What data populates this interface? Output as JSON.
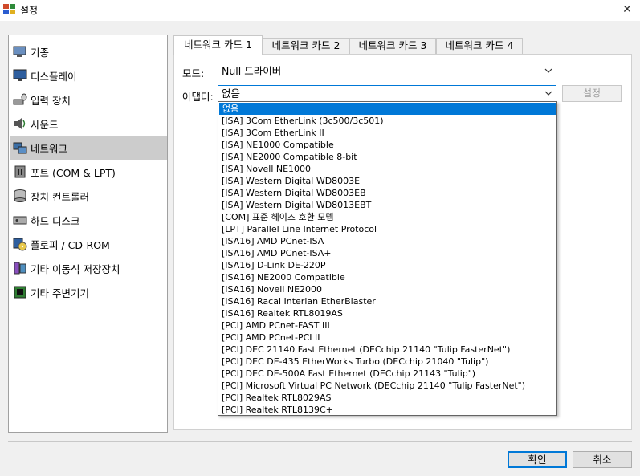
{
  "window": {
    "title": "설정"
  },
  "sidebar": {
    "items": [
      {
        "label": "기종",
        "icon": "machine-icon"
      },
      {
        "label": "디스플레이",
        "icon": "display-icon"
      },
      {
        "label": "입력 장치",
        "icon": "input-device-icon"
      },
      {
        "label": "사운드",
        "icon": "sound-icon"
      },
      {
        "label": "네트워크",
        "icon": "network-icon",
        "selected": true
      },
      {
        "label": "포트 (COM & LPT)",
        "icon": "port-icon"
      },
      {
        "label": "장치 컨트롤러",
        "icon": "controller-icon"
      },
      {
        "label": "하드 디스크",
        "icon": "hard-disk-icon"
      },
      {
        "label": "플로피 / CD-ROM",
        "icon": "floppy-cdrom-icon"
      },
      {
        "label": "기타 이동식 저장장치",
        "icon": "removable-storage-icon"
      },
      {
        "label": "기타 주변기기",
        "icon": "peripherals-icon"
      }
    ]
  },
  "tabs": [
    "네트워크 카드 1",
    "네트워크 카드 2",
    "네트워크 카드 3",
    "네트워크 카드 4"
  ],
  "form": {
    "mode_label": "모드:",
    "mode_value": "Null 드라이버",
    "adapter_label": "어댑터:",
    "adapter_value": "없음",
    "settings_button": "설정"
  },
  "dropdown_options": [
    "없음",
    "[ISA] 3Com EtherLink (3c500/3c501)",
    "[ISA] 3Com EtherLink II",
    "[ISA] NE1000 Compatible",
    "[ISA] NE2000 Compatible 8-bit",
    "[ISA] Novell NE1000",
    "[ISA] Western Digital WD8003E",
    "[ISA] Western Digital WD8003EB",
    "[ISA] Western Digital WD8013EBT",
    "[COM] 표준 헤이즈 호환 모뎀",
    "[LPT] Parallel Line Internet Protocol",
    "[ISA16] AMD PCnet-ISA",
    "[ISA16] AMD PCnet-ISA+",
    "[ISA16] D-Link DE-220P",
    "[ISA16] NE2000 Compatible",
    "[ISA16] Novell NE2000",
    "[ISA16] Racal Interlan EtherBlaster",
    "[ISA16] Realtek RTL8019AS",
    "[PCI] AMD PCnet-FAST III",
    "[PCI] AMD PCnet-PCI II",
    "[PCI] DEC 21140 Fast Ethernet (DECchip 21140 \"Tulip FasterNet\")",
    "[PCI] DEC DE-435 EtherWorks Turbo (DECchip 21040 \"Tulip\")",
    "[PCI] DEC DE-500A Fast Ethernet (DECchip 21143 \"Tulip\")",
    "[PCI] Microsoft Virtual PC Network (DECchip 21140 \"Tulip FasterNet\")",
    "[PCI] Realtek RTL8029AS",
    "[PCI] Realtek RTL8139C+"
  ],
  "buttons": {
    "ok": "확인",
    "cancel": "취소"
  },
  "colors": {
    "accent": "#0078d7",
    "selection_sidebar": "#cccccc"
  }
}
